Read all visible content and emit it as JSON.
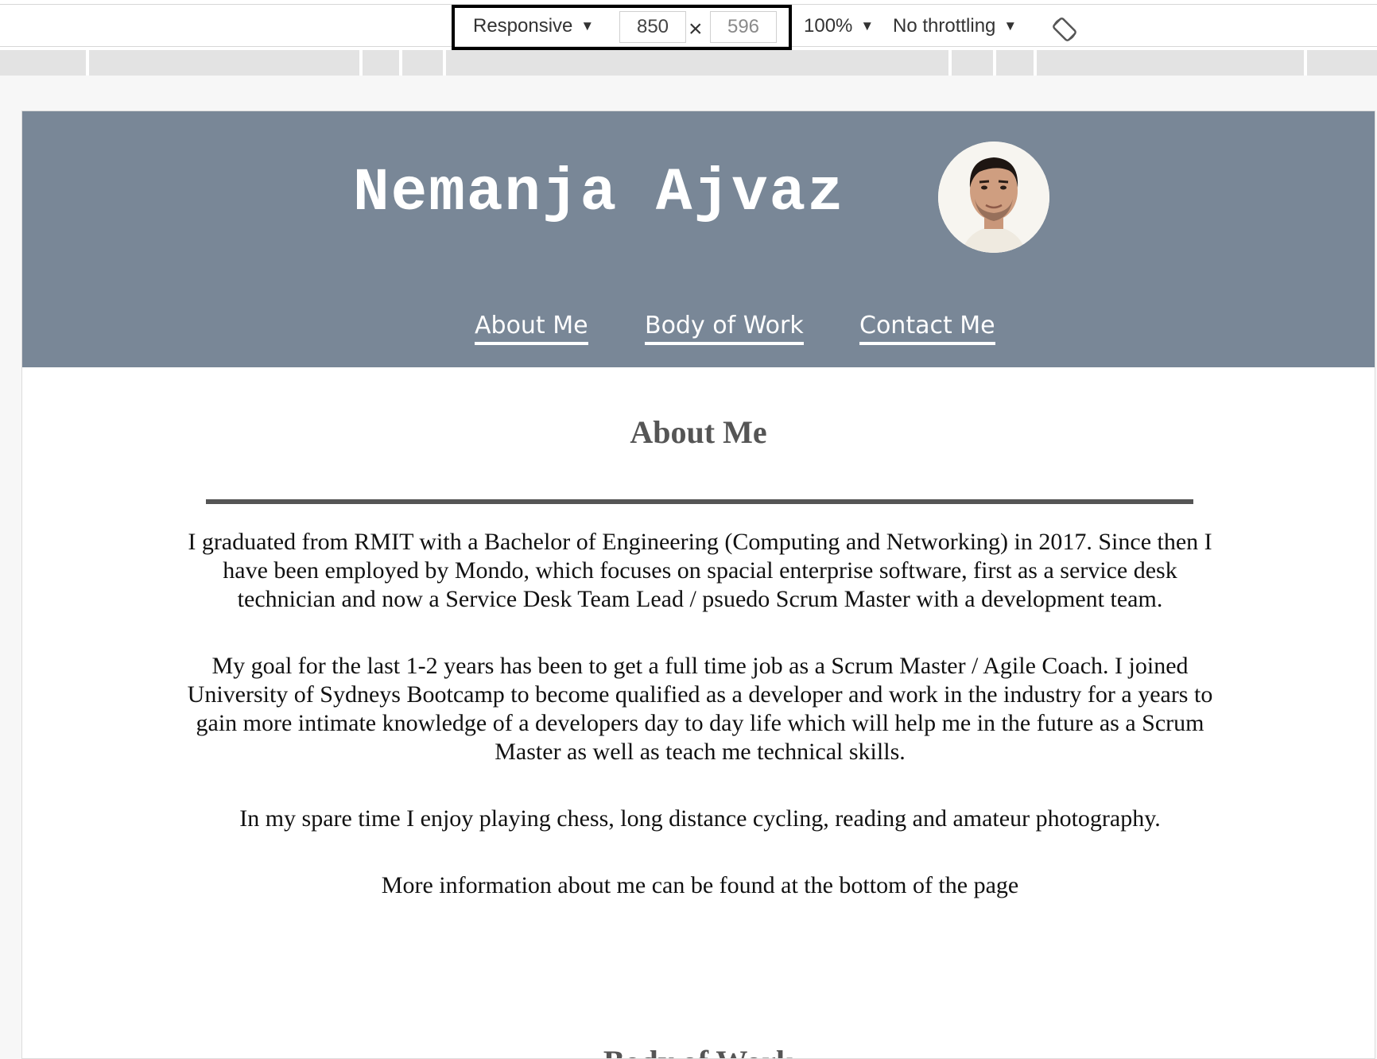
{
  "devtools": {
    "device_mode": "Responsive",
    "width": "850",
    "height": "596",
    "times_symbol": "×",
    "zoom": "100%",
    "throttling": "No throttling",
    "icons": [
      "caret-down-icon",
      "rotate-icon"
    ]
  },
  "site": {
    "name": "Nemanja Ajvaz",
    "nav": [
      {
        "label": "About Me"
      },
      {
        "label": "Body of Work"
      },
      {
        "label": "Contact Me"
      }
    ]
  },
  "about": {
    "heading": "About Me",
    "paragraphs": [
      "I graduated from RMIT with a Bachelor of Engineering (Computing and Networking) in 2017. Since then I have been employed by Mondo, which focuses on spacial enterprise software, first as a service desk technician and now a Service Desk Team Lead / psuedo Scrum Master with a development team.",
      "My goal for the last 1-2 years has been to get a full time job as a Scrum Master / Agile Coach. I joined University of Sydneys Bootcamp to become qualified as a developer and work in the industry for a years to gain more intimate knowledge of a developers day to day life which will help me in the future as a Scrum Master as well as teach me technical skills.",
      "In my spare time I enjoy playing chess, long distance cycling, reading and amateur photography.",
      "More information about me can be found at the bottom of the page"
    ]
  },
  "next_section": {
    "heading": "Body of Work"
  },
  "colors": {
    "header_bg": "#798797",
    "heading_text": "#555555"
  }
}
